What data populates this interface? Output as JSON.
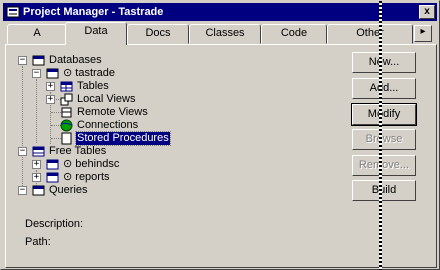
{
  "window": {
    "title": "Project Manager - Tastrade",
    "close_label": "x"
  },
  "tabs": [
    {
      "label": "A"
    },
    {
      "label": "Data"
    },
    {
      "label": "Docs"
    },
    {
      "label": "Classes"
    },
    {
      "label": "Code"
    },
    {
      "label": "Other"
    }
  ],
  "tab_scroll_label": "▸",
  "tree": {
    "databases": "Databases",
    "tastrade": "tastrade",
    "tables": "Tables",
    "local_views": "Local Views",
    "remote_views": "Remote Views",
    "connections": "Connections",
    "stored_procedures": "Stored Procedures",
    "free_tables": "Free Tables",
    "behindsc": "behindsc",
    "reports": "reports",
    "queries": "Queries"
  },
  "buttons": {
    "new": "New...",
    "add": "Add...",
    "modify": "Modify",
    "browse": "Browse",
    "remove": "Remove...",
    "build": "Build"
  },
  "info": {
    "description_label": "Description:",
    "path_label": "Path:"
  }
}
